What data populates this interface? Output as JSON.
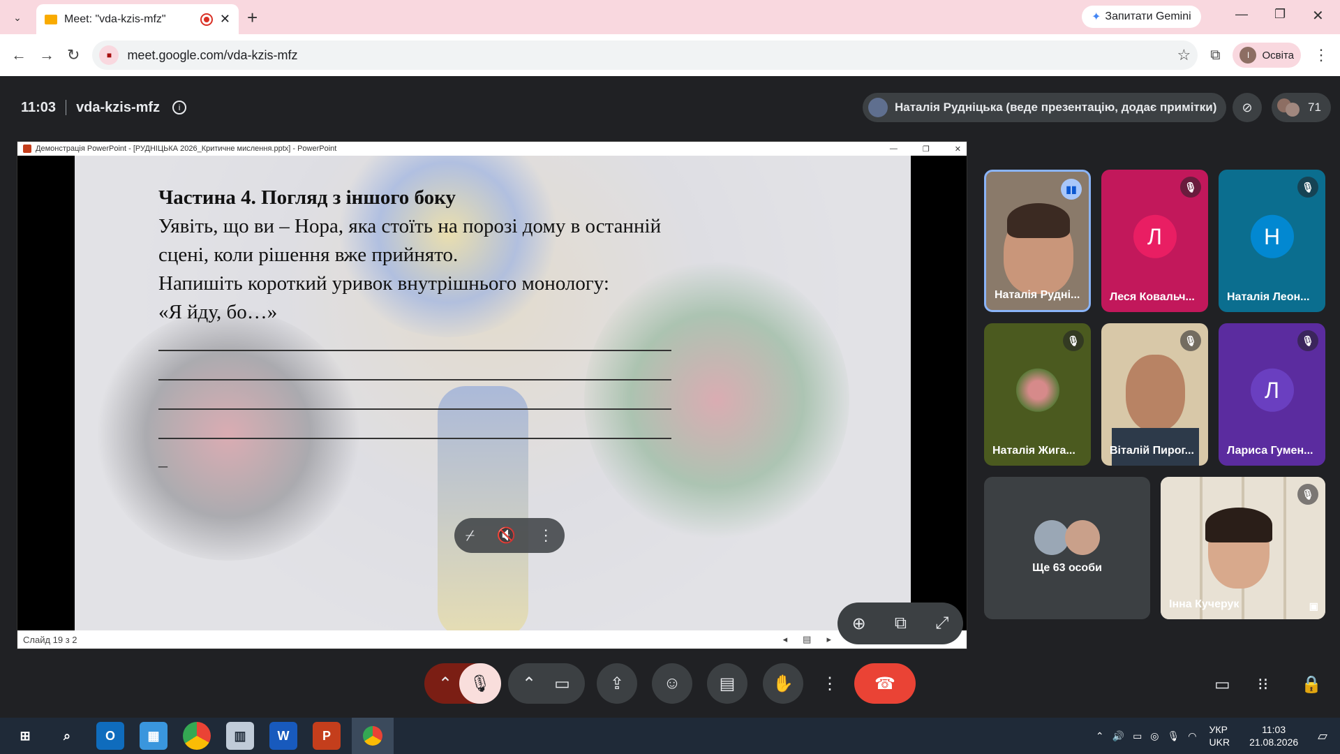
{
  "browser": {
    "tab_title": "Meet: \"vda-kzis-mfz\"",
    "gemini_label": "Запитати Gemini",
    "url": "meet.google.com/vda-kzis-mfz",
    "profile_label": "Освіта",
    "profile_initial": "I"
  },
  "meet": {
    "time": "11:03",
    "meeting_code": "vda-kzis-mfz",
    "presenter_label": "Наталія Рудніцька (веде презентацію, додає примітки)",
    "participant_count": "71"
  },
  "presentation": {
    "window_title": "Демонстрація PowerPoint - [РУДНІЦЬКА 2026_Критичне мислення.pptx] - PowerPoint",
    "slide_heading": "Частина 4. Погляд з іншого боку",
    "slide_lines": [
      "Уявіть, що ви – Нора, яка стоїть на порозі дому в останній",
      "сцені, коли рішення вже прийнято.",
      "Напишіть короткий уривок внутрішнього монологу:",
      "«Я йду, бо…»"
    ],
    "slide_dash": "_",
    "status": "Слайд 19 з 2"
  },
  "tiles": [
    {
      "name": "Наталія Рудні...",
      "initial": "",
      "color": "#8a7a6a",
      "mic": "speaking"
    },
    {
      "name": "Леся Ковальч...",
      "initial": "Л",
      "color": "#c2185b",
      "avatar_color": "#e91e63",
      "mic": "muted"
    },
    {
      "name": "Наталія Леон...",
      "initial": "Н",
      "color": "#0b6e8f",
      "avatar_color": "#0288d1",
      "mic": "muted"
    },
    {
      "name": "Наталія Жига...",
      "initial": "",
      "color": "#4b5a1f",
      "mic": "muted"
    },
    {
      "name": "Віталій Пирог...",
      "initial": "",
      "color": "#6b5a48",
      "mic": "muted"
    },
    {
      "name": "Лариса Гумен...",
      "initial": "Л",
      "color": "#5b2c9f",
      "avatar_color": "#6a3fc0",
      "mic": "muted"
    }
  ],
  "others_label": "Ще 63 особи",
  "inna_name": "Інна Кучерук",
  "taskbar": {
    "lang_top": "УКР",
    "lang_bottom": "UKR",
    "time": "11:03",
    "date": "21.08.2026"
  },
  "colors": {
    "end_call": "#ea4335",
    "mic_off": "#f9dedc",
    "raise_bg": "#7b1e14"
  }
}
